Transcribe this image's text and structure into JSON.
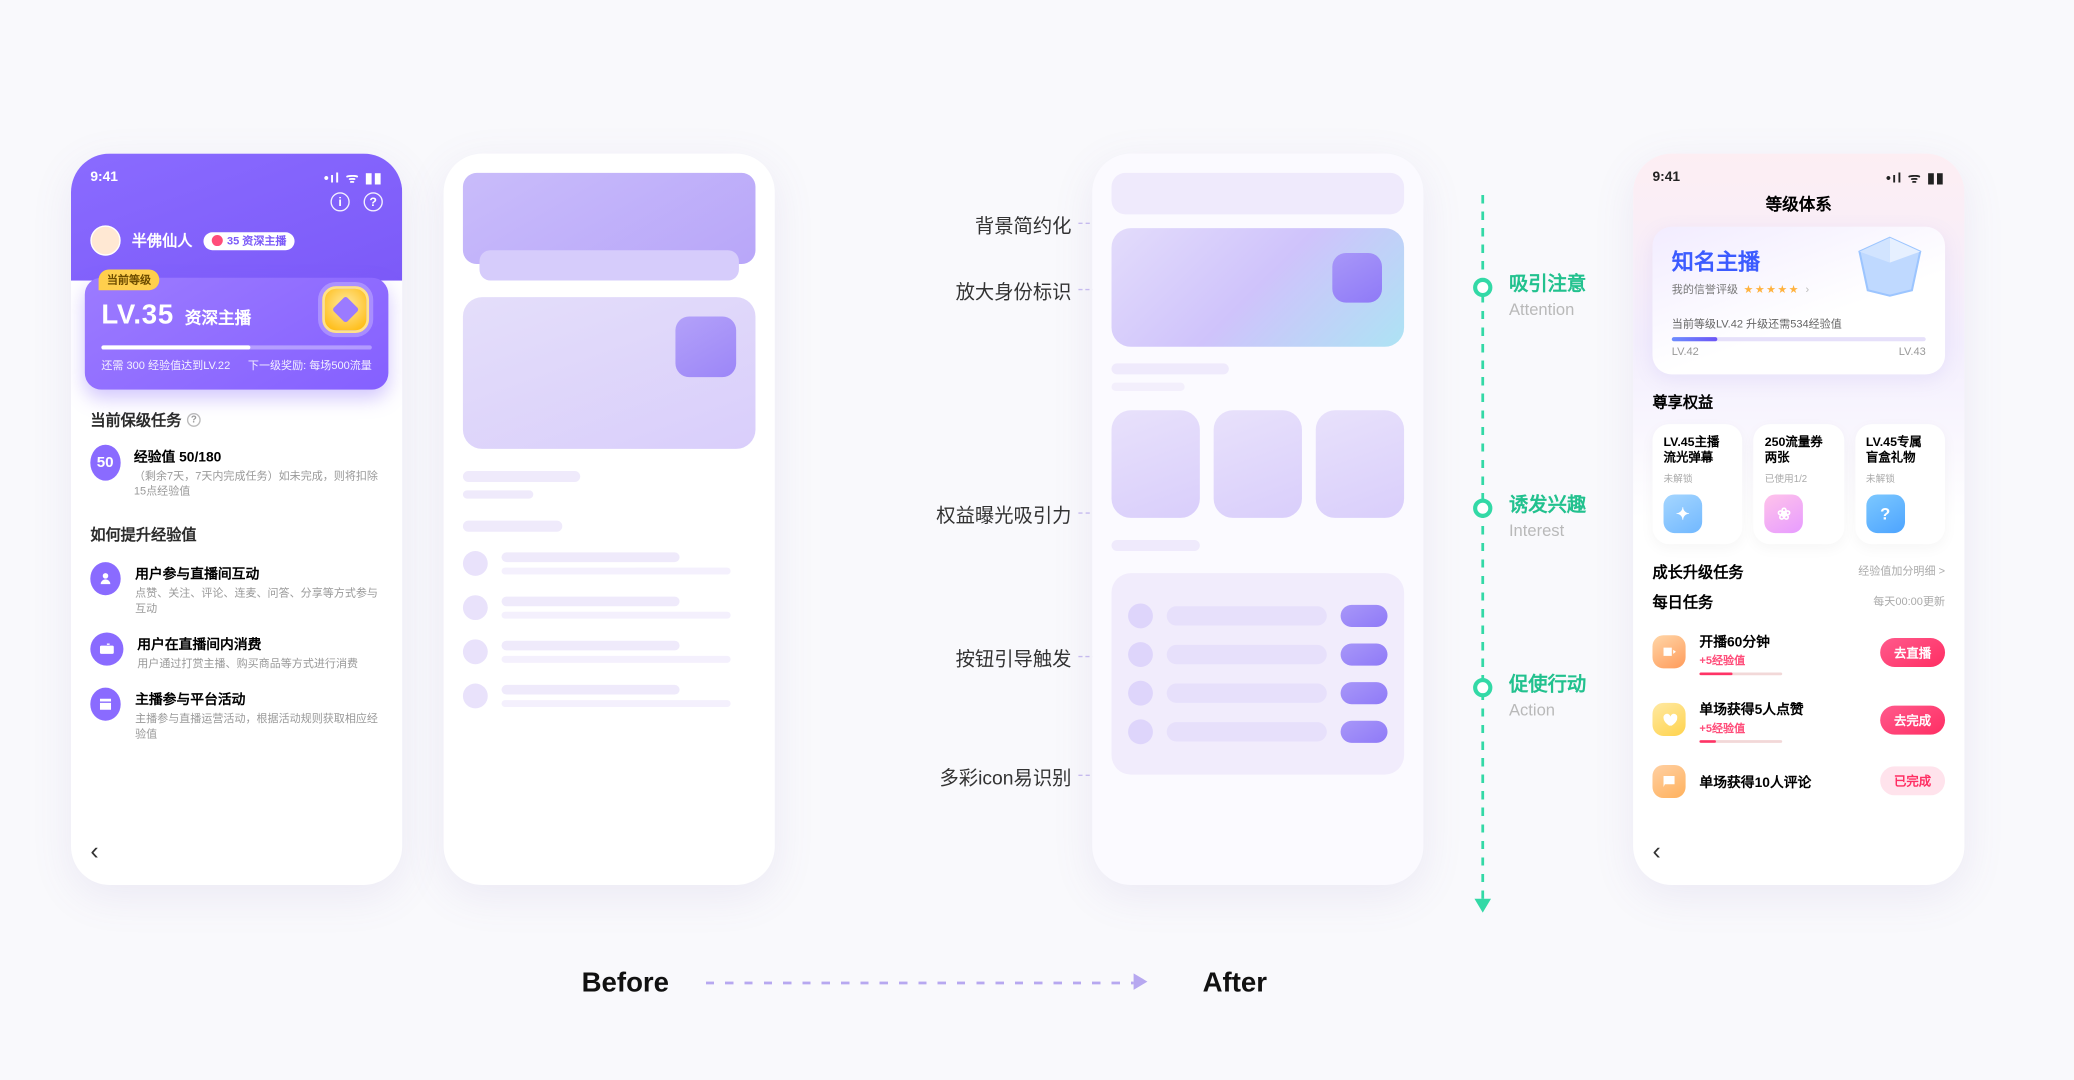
{
  "labels": {
    "before": "Before",
    "after": "After"
  },
  "phone1": {
    "time": "9:41",
    "username": "半佛仙人",
    "user_badge": "35 资深主播",
    "current_tag": "当前等级",
    "lv": "LV.35",
    "lv_name": "资深主播",
    "progress_left": "还需 300 经验值达到LV.22",
    "progress_right": "下一级奖励: 每场500流量",
    "task_title": "当前保级任务",
    "task_num": "50",
    "task_line1": "经验值 50/180",
    "task_line2": "（剩余7天，7天内完成任务）如未完成，则将扣除15点经验值",
    "how_title": "如何提升经验值",
    "ways": [
      {
        "t": "用户参与直播间互动",
        "s": "点赞、关注、评论、连麦、问答、分享等方式参与互动"
      },
      {
        "t": "用户在直播间内消费",
        "s": "用户通过打赏主播、购买商品等方式进行消费"
      },
      {
        "t": "主播参与平台活动",
        "s": "主播参与直播运营活动，根据活动规则获取相应经验值"
      }
    ]
  },
  "callouts_left": [
    "背景简约化",
    "放大身份标识",
    "权益曝光吸引力",
    "按钮引导触发",
    "多彩icon易识别"
  ],
  "stages": [
    {
      "zh": "吸引注意",
      "en": "Attention"
    },
    {
      "zh": "诱发兴趣",
      "en": "Interest"
    },
    {
      "zh": "促使行动",
      "en": "Action"
    }
  ],
  "phone4": {
    "time": "9:41",
    "page_title": "等级体系",
    "name": "知名主播",
    "credit_label": "我的信誉评级",
    "progress_text": "当前等级LV.42   升级还需534经验值",
    "lv_from": "LV.42",
    "lv_to": "LV.43",
    "perks_title": "尊享权益",
    "perks": [
      {
        "t1": "LV.45主播",
        "t2": "流光弹幕",
        "s": "未解锁"
      },
      {
        "t1": "250流量券",
        "t2": "两张",
        "s": "已使用1/2"
      },
      {
        "t1": "LV.45专属",
        "t2": "盲盒礼物",
        "s": "未解锁"
      }
    ],
    "growth_title": "成长升级任务",
    "growth_more": "经验值加分明细 >",
    "daily_title": "每日任务",
    "daily_more": "每天00:00更新",
    "tasks": [
      {
        "t": "开播60分钟",
        "s": "+5经验值",
        "btn": "去直播",
        "btnStyle": "red",
        "prog": 40
      },
      {
        "t": "单场获得5人点赞",
        "s": "+5经验值",
        "btn": "去完成",
        "btnStyle": "red",
        "prog": 20
      },
      {
        "t": "单场获得10人评论",
        "s": "",
        "btn": "已完成",
        "btnStyle": "done",
        "prog": 100
      }
    ]
  }
}
